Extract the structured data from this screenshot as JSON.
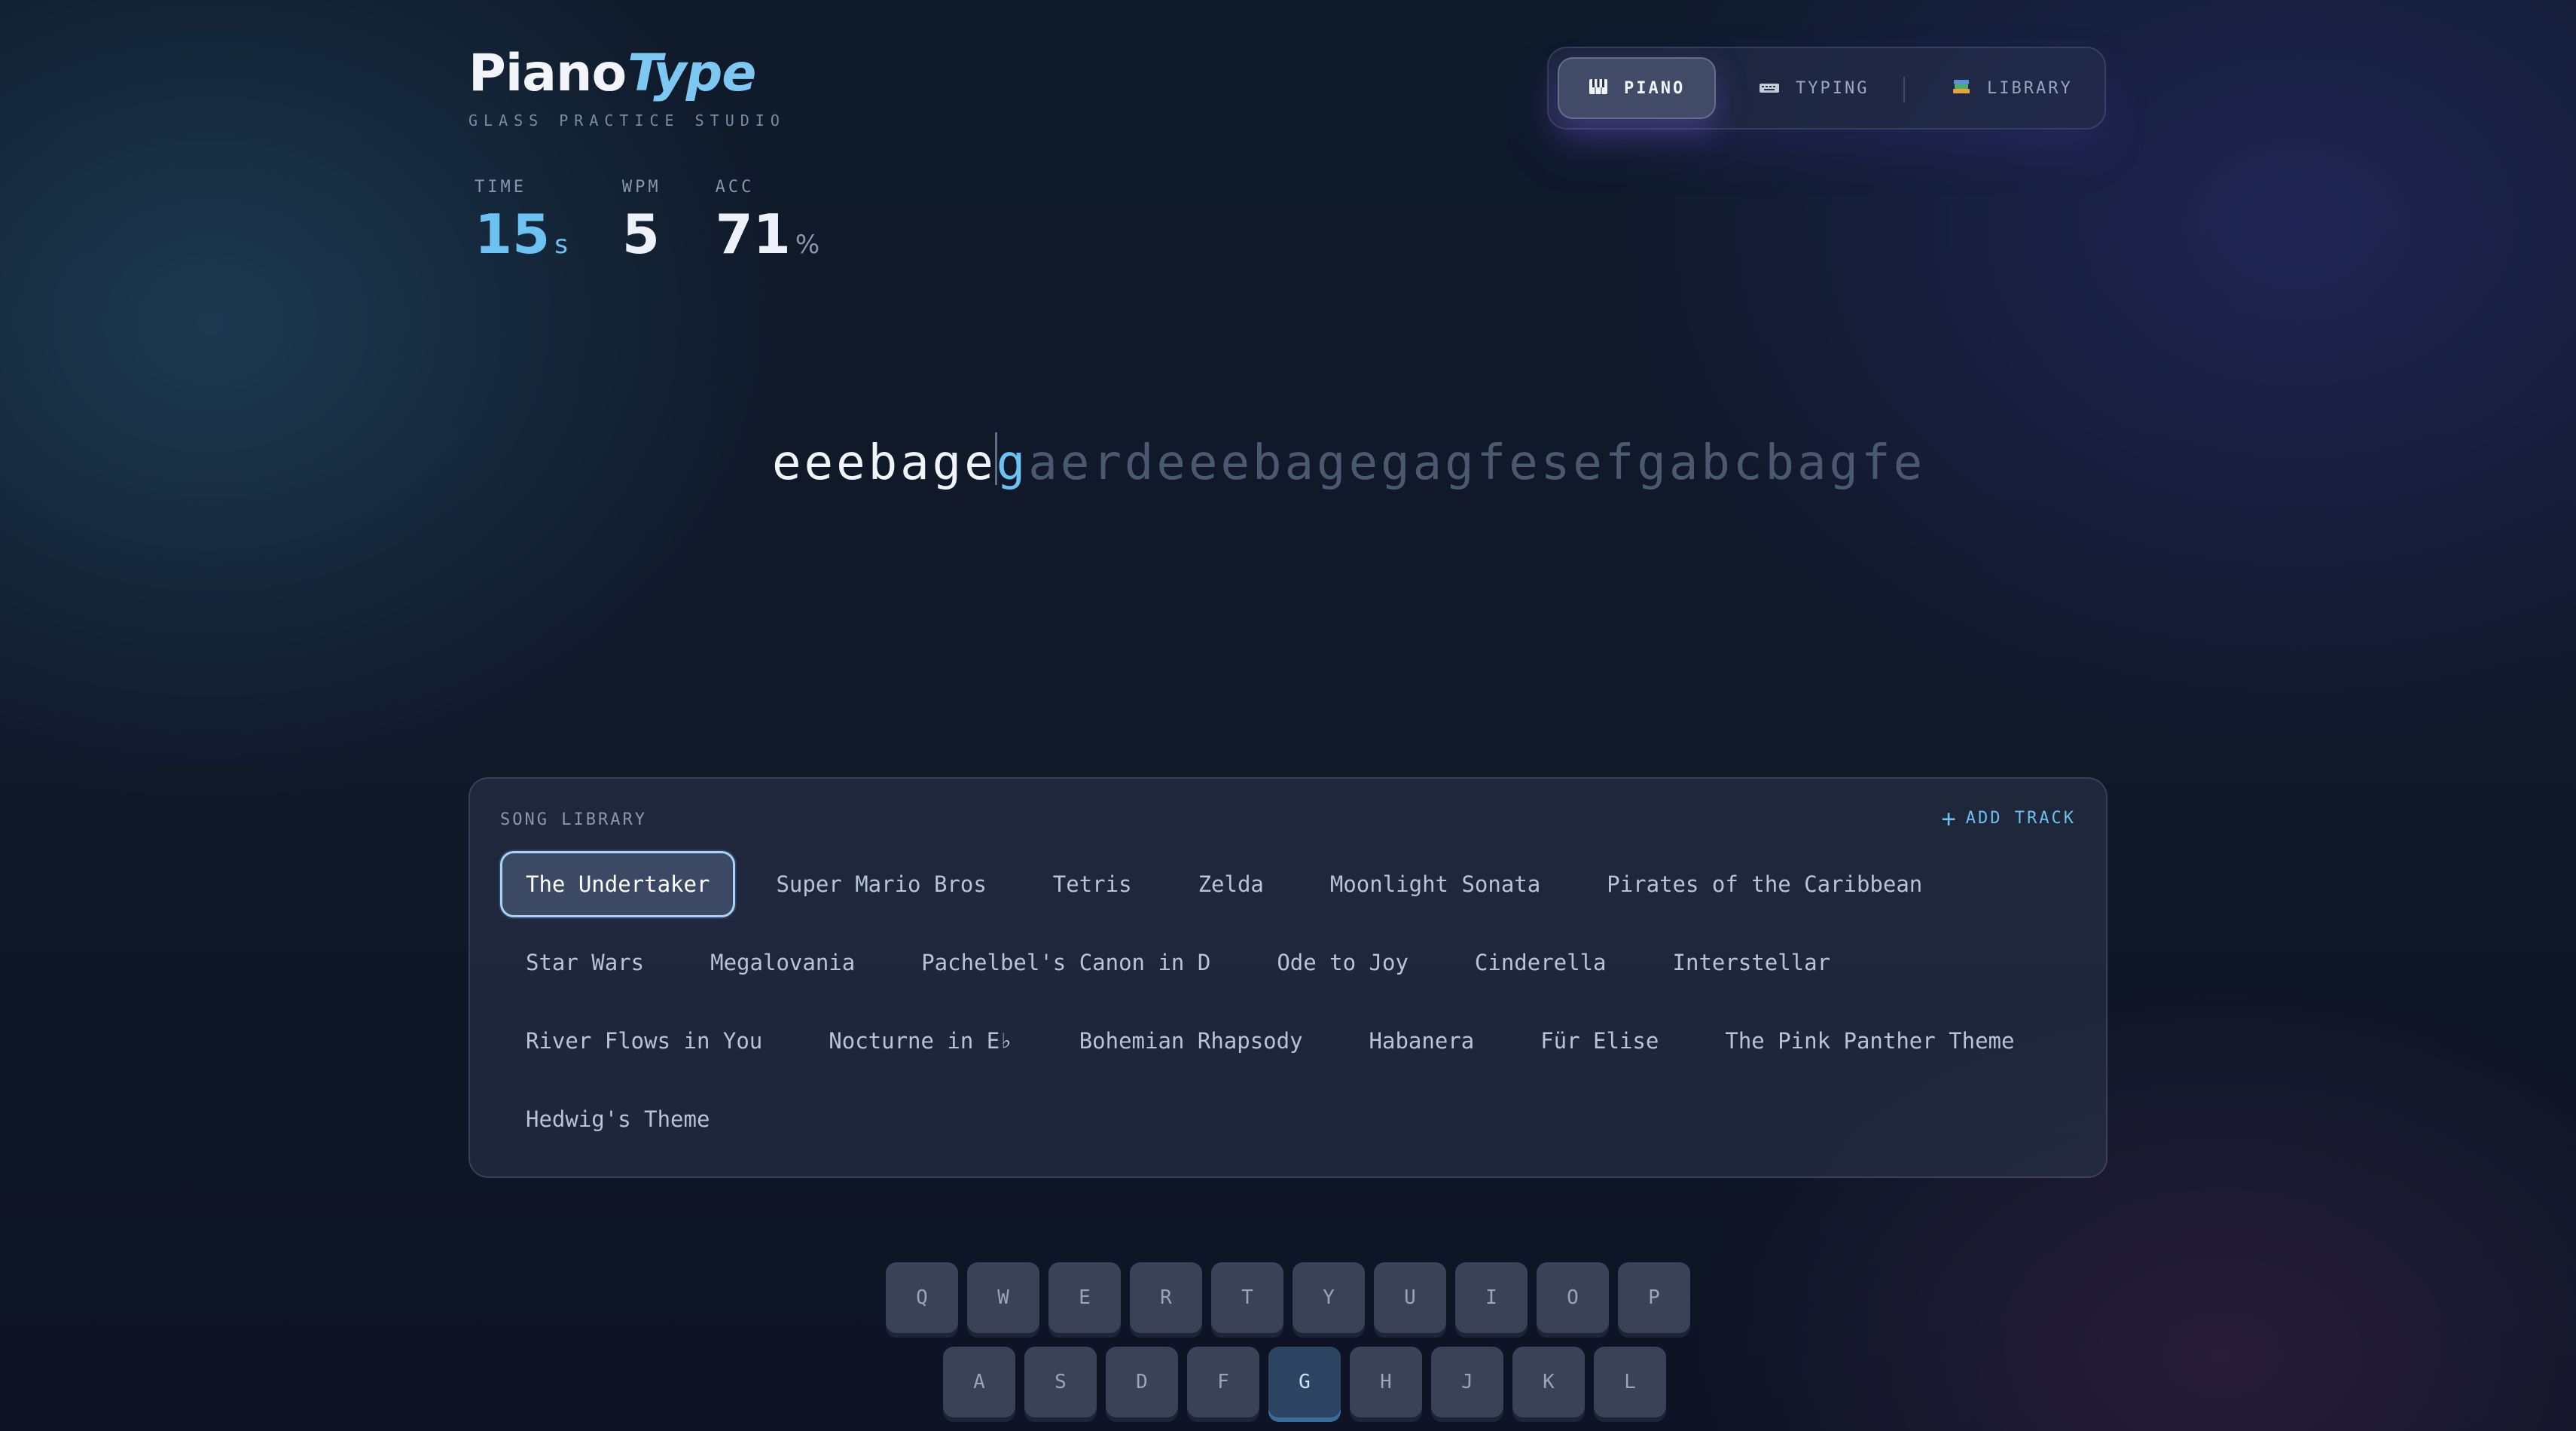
{
  "brand": {
    "title_main": "Piano",
    "title_accent": "Type",
    "subtitle": "GLASS PRACTICE STUDIO"
  },
  "nav": {
    "items": [
      {
        "label": "PIANO",
        "icon": "piano-keys-icon",
        "active": true
      },
      {
        "label": "TYPING",
        "icon": "keyboard-icon",
        "active": false
      },
      {
        "label": "LIBRARY",
        "icon": "books-icon",
        "active": false
      }
    ]
  },
  "stats": {
    "time": {
      "label": "TIME",
      "value": "15",
      "unit": "s"
    },
    "wpm": {
      "label": "WPM",
      "value": "5"
    },
    "acc": {
      "label": "ACC",
      "value": "71",
      "unit": "%"
    }
  },
  "typing": {
    "typed": "eeebage",
    "current": "g",
    "pending": "aerdeeebagegagfesefgabcbagfe"
  },
  "library": {
    "label": "SONG LIBRARY",
    "add_label": "ADD TRACK",
    "rows": [
      [
        "The Undertaker",
        "Super Mario Bros",
        "Tetris",
        "Zelda",
        "Moonlight Sonata",
        "Pirates of the Caribbean"
      ],
      [
        "Star Wars",
        "Megalovania",
        "Pachelbel's Canon in D",
        "Ode to Joy",
        "Cinderella",
        "Interstellar"
      ],
      [
        "River Flows in You",
        "Nocturne in E♭",
        "Bohemian Rhapsody",
        "Habanera",
        "Für Elise",
        "The Pink Panther Theme"
      ],
      [
        "Hedwig's Theme"
      ]
    ],
    "selected": "The Undertaker"
  },
  "keyboard": {
    "row1": [
      "Q",
      "W",
      "E",
      "R",
      "T",
      "Y",
      "U",
      "I",
      "O",
      "P"
    ],
    "row2": [
      "A",
      "S",
      "D",
      "F",
      "G",
      "H",
      "J",
      "K",
      "L"
    ],
    "active_key": "G"
  },
  "colors": {
    "accent": "#6cc2f0",
    "background": "#101829",
    "pending_text": "#4a5870"
  }
}
